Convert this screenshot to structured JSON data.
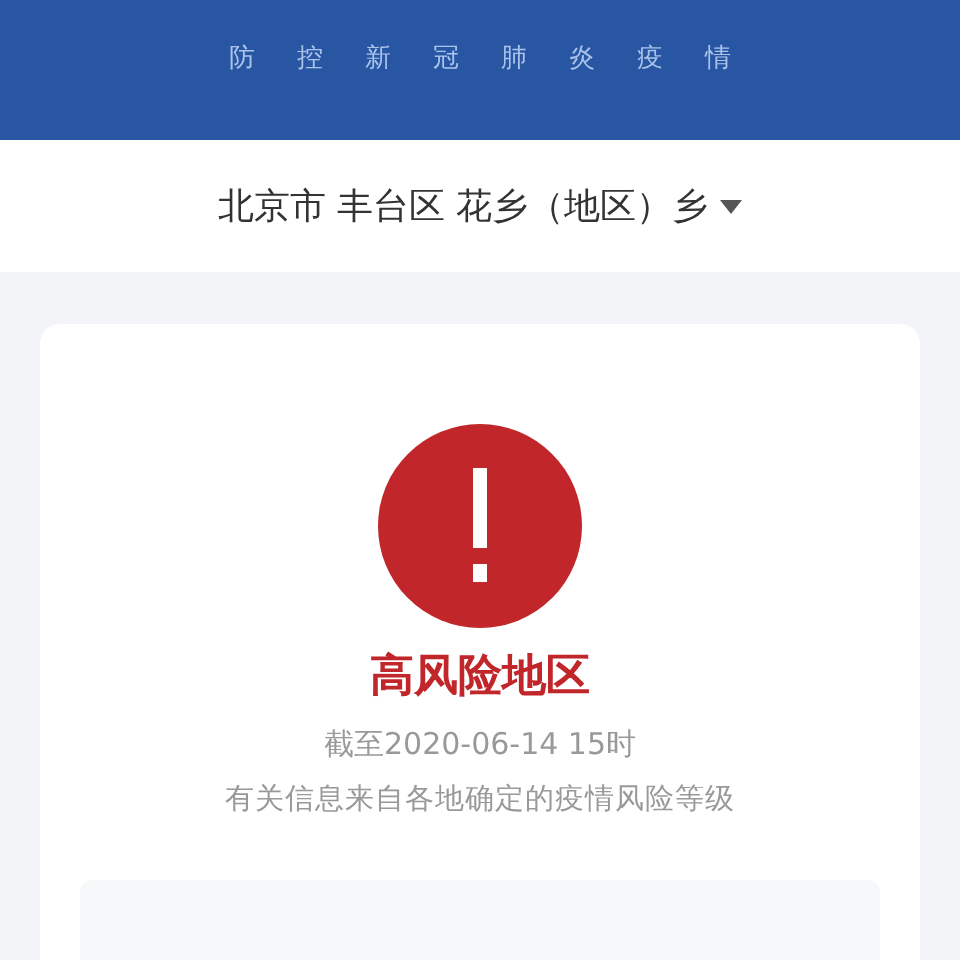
{
  "header": {
    "subtitle": "防控新冠肺炎疫情"
  },
  "location": {
    "value": "北京市 丰台区 花乡（地区）乡"
  },
  "result": {
    "kind": "warning",
    "color": "#c0262a",
    "label": "高风险地区",
    "updated": "截至2020-06-14 15时",
    "note": "有关信息来自各地确定的疫情风险等级"
  }
}
